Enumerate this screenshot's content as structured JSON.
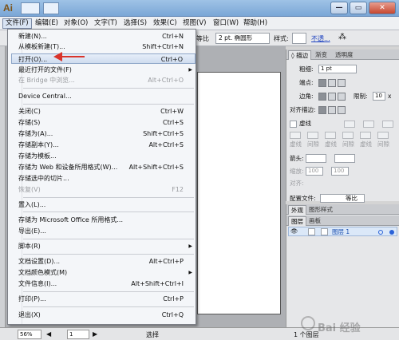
{
  "app": {
    "logo": "Ai",
    "window_buttons": [
      "—",
      "▭",
      "✕"
    ]
  },
  "menubar": {
    "items": [
      "文件(F)",
      "编辑(E)",
      "对象(O)",
      "文字(T)",
      "选择(S)",
      "效果(C)",
      "视图(V)",
      "窗口(W)",
      "帮助(H)"
    ]
  },
  "controlbar": {
    "ratio_label": "等比",
    "stroke_value": "2 pt. 椭圆形",
    "style_label": "样式:",
    "opacity_link": "不透..."
  },
  "file_menu": {
    "items": [
      {
        "label": "新建(N)...",
        "shortcut": "Ctrl+N"
      },
      {
        "label": "从模板新建(T)...",
        "shortcut": "Shift+Ctrl+N"
      },
      {
        "label": "打开(O)...",
        "shortcut": "Ctrl+O"
      },
      {
        "label": "最近打开的文件(F)",
        "shortcut": ""
      },
      {
        "label": "在 Bridge 中浏览...",
        "shortcut": "Alt+Ctrl+O"
      },
      {
        "label": "Device Central...",
        "shortcut": ""
      },
      {
        "label": "关闭(C)",
        "shortcut": "Ctrl+W"
      },
      {
        "label": "存储(S)",
        "shortcut": "Ctrl+S"
      },
      {
        "label": "存储为(A)...",
        "shortcut": "Shift+Ctrl+S"
      },
      {
        "label": "存储副本(Y)...",
        "shortcut": "Alt+Ctrl+S"
      },
      {
        "label": "存储为模板...",
        "shortcut": ""
      },
      {
        "label": "存储为 Web 和设备所用格式(W)...",
        "shortcut": "Alt+Shift+Ctrl+S"
      },
      {
        "label": "存储选中的切片...",
        "shortcut": ""
      },
      {
        "label": "恢复(V)",
        "shortcut": "F12"
      },
      {
        "label": "置入(L)...",
        "shortcut": ""
      },
      {
        "label": "存储为 Microsoft Office 所用格式...",
        "shortcut": ""
      },
      {
        "label": "导出(E)...",
        "shortcut": ""
      },
      {
        "label": "脚本(R)",
        "shortcut": ""
      },
      {
        "label": "文档设置(D)...",
        "shortcut": "Alt+Ctrl+P"
      },
      {
        "label": "文档颜色模式(M)",
        "shortcut": ""
      },
      {
        "label": "文件信息(I)...",
        "shortcut": "Alt+Shift+Ctrl+I"
      },
      {
        "label": "打印(P)...",
        "shortcut": "Ctrl+P"
      },
      {
        "label": "退出(X)",
        "shortcut": "Ctrl+Q"
      }
    ]
  },
  "stroke_panel": {
    "tabs": [
      "◊ 描边",
      "渐变",
      "透明度"
    ],
    "weight_label": "粗细:",
    "weight_value": "1 pt",
    "cap_label": "端点:",
    "corner_label": "边角:",
    "limit_label": "限制:",
    "limit_value": "10",
    "limit_unit": "x",
    "align_label": "对齐描边:",
    "dashed_label": "虚线",
    "dash_labels": [
      "虚线",
      "间隙",
      "虚线",
      "间隙",
      "虚线",
      "间隙"
    ],
    "arrow_label": "箭头:",
    "scale_label": "缩放:",
    "scale_values": [
      "100",
      "100"
    ],
    "align_arrow_label": "对齐:",
    "profile_label": "配置文件:",
    "profile_value": "等比"
  },
  "layers_panel": {
    "tabs": [
      "外观",
      "图形样式"
    ],
    "subtabs": [
      "图层",
      "画板"
    ],
    "layer_name": "图层 1",
    "eye_icon": "👁"
  },
  "statusbar": {
    "zoom": "56%",
    "artboard_num": "1",
    "tool_name": "选择",
    "object_count": "1 个图层"
  },
  "watermark": {
    "text": "Bai 经验"
  },
  "colors": {
    "highlight": "#cfdcef",
    "accent_red": "#d9342b",
    "layer_target": "#2a62d8"
  }
}
